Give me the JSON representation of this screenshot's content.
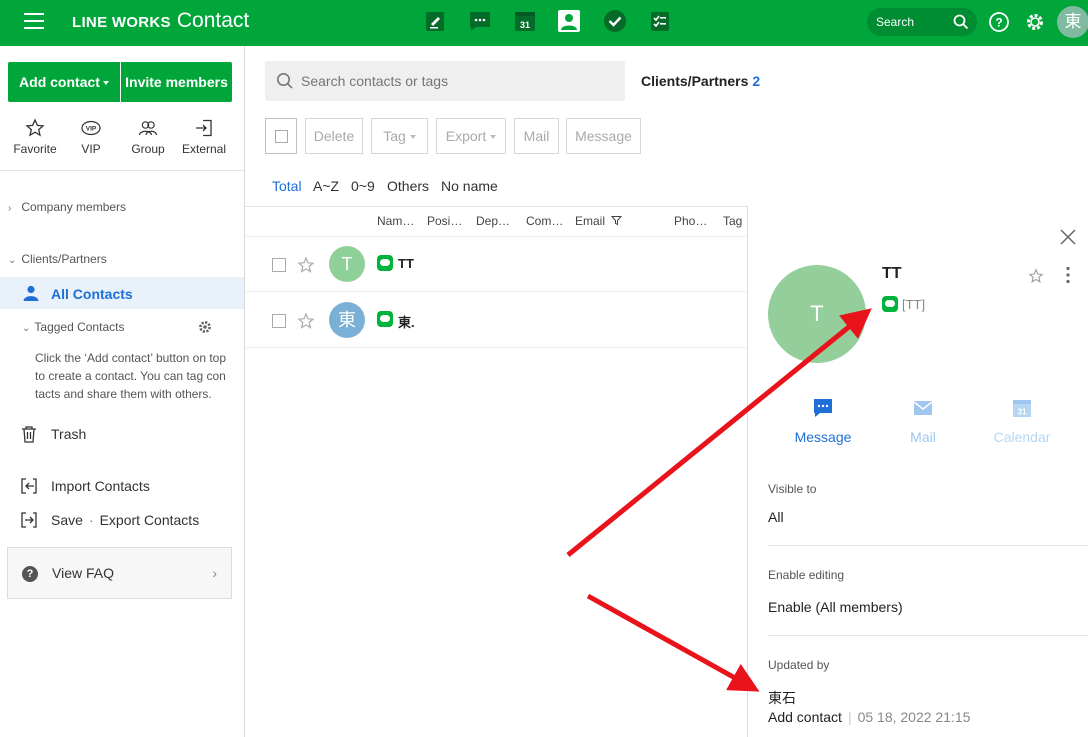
{
  "brand": {
    "name": "LINE WORKS",
    "product": "Contact"
  },
  "topbar": {
    "apps": [
      "board-icon",
      "message-icon",
      "calendar-icon",
      "contact-icon",
      "task-icon",
      "form-icon"
    ],
    "search_label": "Search",
    "avatar_char": "東"
  },
  "sidebar": {
    "add_contact": "Add contact",
    "invite_members": "Invite members",
    "quick": [
      "Favorite",
      "VIP",
      "Group",
      "External"
    ],
    "company_members": "Company members",
    "clients_partners": "Clients/Partners",
    "all_contacts": "All Contacts",
    "tagged_contacts": "Tagged Contacts",
    "help_text": "Click the ‘Add contact’ button on top to create a contact. You can tag con tacts and share them with others.",
    "trash": "Trash",
    "import": "Import Contacts",
    "save": "Save",
    "export": "Export Contacts",
    "faq": "View FAQ"
  },
  "main": {
    "search_placeholder": "Search contacts or tags",
    "title": "Clients/Partners",
    "count": "2",
    "toolbar": {
      "delete": "Delete",
      "tag": "Tag",
      "export": "Export",
      "mail": "Mail",
      "message": "Message"
    },
    "filters": [
      "Total",
      "A~Z",
      "0~9",
      "Others",
      "No name"
    ],
    "columns": [
      "Nam…",
      "Posi…",
      "Dep…",
      "Com…",
      "Email",
      "Pho…",
      "Tag"
    ],
    "rows": [
      {
        "avatar": "T",
        "avatar_color": "#8fcf98",
        "name": "TT"
      },
      {
        "avatar": "東",
        "avatar_color": "#7ab0d6",
        "name": "東."
      }
    ]
  },
  "detail": {
    "avatar": "T",
    "name": "TT",
    "line_name": "[TT]",
    "actions": [
      "Message",
      "Mail",
      "Calendar"
    ],
    "visible_to_label": "Visible to",
    "visible_to": "All",
    "enable_editing_label": "Enable editing",
    "enable_editing": "Enable (All members)",
    "updated_by_label": "Updated by",
    "updated_by": "東石",
    "update_action": "Add contact",
    "update_time": "05 18, 2022 21:15"
  },
  "colors": {
    "brand_green": "#00a63a",
    "link_blue": "#1f6fd6",
    "annotation_red": "#e8131b"
  }
}
